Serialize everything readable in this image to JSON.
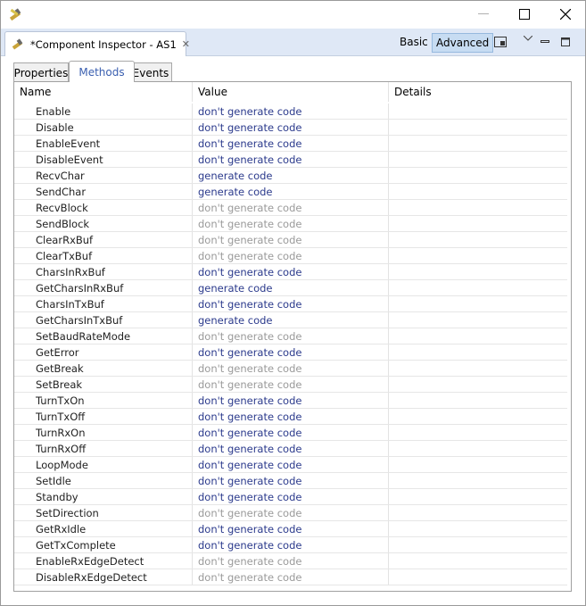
{
  "window": {
    "app_icon": "wrench-pencil-icon"
  },
  "view": {
    "title": "*Component Inspector - AS1",
    "mode_basic": "Basic",
    "mode_advanced": "Advanced"
  },
  "subtabs": {
    "properties": "Properties",
    "methods": "Methods",
    "events": "Events",
    "selected": "Methods"
  },
  "table": {
    "columns": [
      "Name",
      "Value",
      "Details"
    ],
    "rows": [
      {
        "name": "Enable",
        "value": "don't generate code",
        "enabled": true
      },
      {
        "name": "Disable",
        "value": "don't generate code",
        "enabled": true
      },
      {
        "name": "EnableEvent",
        "value": "don't generate code",
        "enabled": true
      },
      {
        "name": "DisableEvent",
        "value": "don't generate code",
        "enabled": true
      },
      {
        "name": "RecvChar",
        "value": "generate code",
        "enabled": true
      },
      {
        "name": "SendChar",
        "value": "generate code",
        "enabled": true
      },
      {
        "name": "RecvBlock",
        "value": "don't generate code",
        "enabled": false
      },
      {
        "name": "SendBlock",
        "value": "don't generate code",
        "enabled": false
      },
      {
        "name": "ClearRxBuf",
        "value": "don't generate code",
        "enabled": false
      },
      {
        "name": "ClearTxBuf",
        "value": "don't generate code",
        "enabled": false
      },
      {
        "name": "CharsInRxBuf",
        "value": "don't generate code",
        "enabled": true
      },
      {
        "name": "GetCharsInRxBuf",
        "value": "generate code",
        "enabled": true
      },
      {
        "name": "CharsInTxBuf",
        "value": "don't generate code",
        "enabled": true
      },
      {
        "name": "GetCharsInTxBuf",
        "value": "generate code",
        "enabled": true
      },
      {
        "name": "SetBaudRateMode",
        "value": "don't generate code",
        "enabled": false
      },
      {
        "name": "GetError",
        "value": "don't generate code",
        "enabled": true
      },
      {
        "name": "GetBreak",
        "value": "don't generate code",
        "enabled": false
      },
      {
        "name": "SetBreak",
        "value": "don't generate code",
        "enabled": false
      },
      {
        "name": "TurnTxOn",
        "value": "don't generate code",
        "enabled": true
      },
      {
        "name": "TurnTxOff",
        "value": "don't generate code",
        "enabled": true
      },
      {
        "name": "TurnRxOn",
        "value": "don't generate code",
        "enabled": true
      },
      {
        "name": "TurnRxOff",
        "value": "don't generate code",
        "enabled": true
      },
      {
        "name": "LoopMode",
        "value": "don't generate code",
        "enabled": true
      },
      {
        "name": "SetIdle",
        "value": "don't generate code",
        "enabled": true
      },
      {
        "name": "Standby",
        "value": "don't generate code",
        "enabled": true
      },
      {
        "name": "SetDirection",
        "value": "don't generate code",
        "enabled": false
      },
      {
        "name": "GetRxIdle",
        "value": "don't generate code",
        "enabled": true
      },
      {
        "name": "GetTxComplete",
        "value": "don't generate code",
        "enabled": true
      },
      {
        "name": "EnableRxEdgeDetect",
        "value": "don't generate code",
        "enabled": false
      },
      {
        "name": "DisableRxEdgeDetect",
        "value": "don't generate code",
        "enabled": false
      }
    ]
  },
  "colors": {
    "active_value": "#2b3a8c",
    "inactive_value": "#9a9a9a",
    "viewbar_bg": "#dfe8f6",
    "advanced_selected_bg": "#c7dcf2"
  }
}
